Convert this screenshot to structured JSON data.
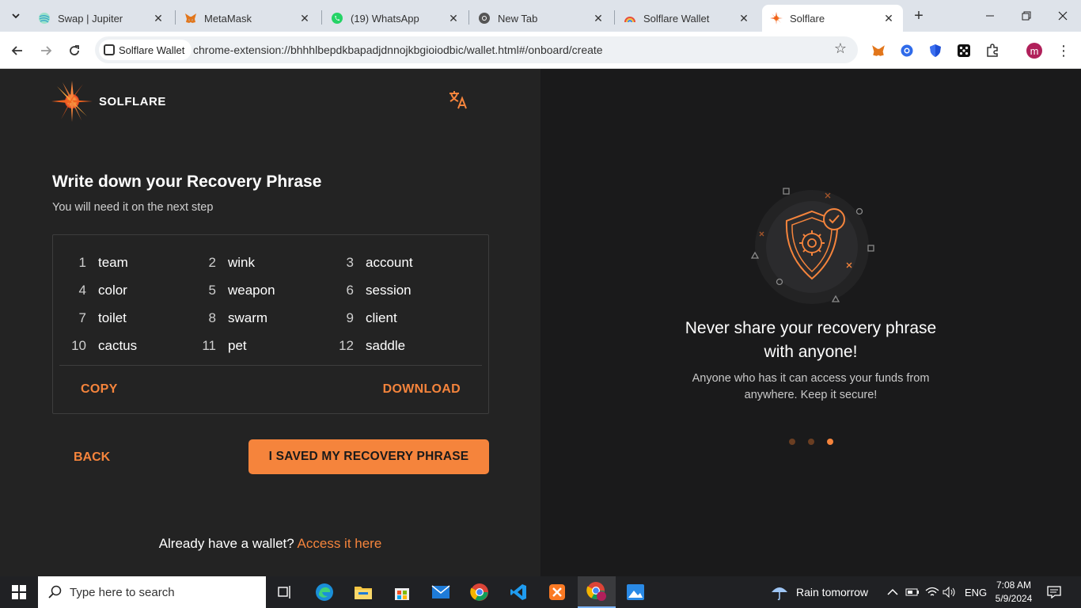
{
  "browser": {
    "tabs": [
      {
        "title": "Swap | Jupiter",
        "icon": "jupiter-icon"
      },
      {
        "title": "MetaMask",
        "icon": "metamask-fox-icon"
      },
      {
        "title": "(19) WhatsApp",
        "icon": "whatsapp-icon"
      },
      {
        "title": "New Tab",
        "icon": "chrome-icon"
      },
      {
        "title": "Solflare Wallet",
        "icon": "solflare-rainbow-icon"
      },
      {
        "title": "Solflare",
        "icon": "solflare-sun-icon",
        "active": true
      }
    ],
    "chip_label": "Solflare Wallet",
    "url": "chrome-extension://bhhhlbepdkbapadjdnnojkbgioiodbic/wallet.html#/onboard/create",
    "profile_initial": "m"
  },
  "left": {
    "brand": "SOLFLARE",
    "title": "Write down your Recovery Phrase",
    "subtitle": "You will need it on the next step",
    "words": [
      {
        "n": "1",
        "w": "team"
      },
      {
        "n": "2",
        "w": "wink"
      },
      {
        "n": "3",
        "w": "account"
      },
      {
        "n": "4",
        "w": "color"
      },
      {
        "n": "5",
        "w": "weapon"
      },
      {
        "n": "6",
        "w": "session"
      },
      {
        "n": "7",
        "w": "toilet"
      },
      {
        "n": "8",
        "w": "swarm"
      },
      {
        "n": "9",
        "w": "client"
      },
      {
        "n": "10",
        "w": "cactus"
      },
      {
        "n": "11",
        "w": "pet"
      },
      {
        "n": "12",
        "w": "saddle"
      }
    ],
    "copy_label": "COPY",
    "download_label": "DOWNLOAD",
    "back_label": "BACK",
    "saved_label": "I SAVED MY RECOVERY PHRASE",
    "already_text": "Already have a wallet?",
    "access_link": "Access it here"
  },
  "right": {
    "title_line1": "Never share your recovery phrase",
    "title_line2": "with anyone!",
    "text_line1": "Anyone who has it can access your funds from",
    "text_line2": "anywhere. Keep it secure!",
    "pager": {
      "count": 3,
      "active_index": 2
    }
  },
  "taskbar": {
    "search_placeholder": "Type here to search",
    "weather": "Rain tomorrow",
    "lang": "ENG",
    "time": "7:08 AM",
    "date": "5/9/2024"
  },
  "colors": {
    "accent": "#f5843c",
    "left_bg": "#232323",
    "right_bg": "#1a1a1b"
  }
}
